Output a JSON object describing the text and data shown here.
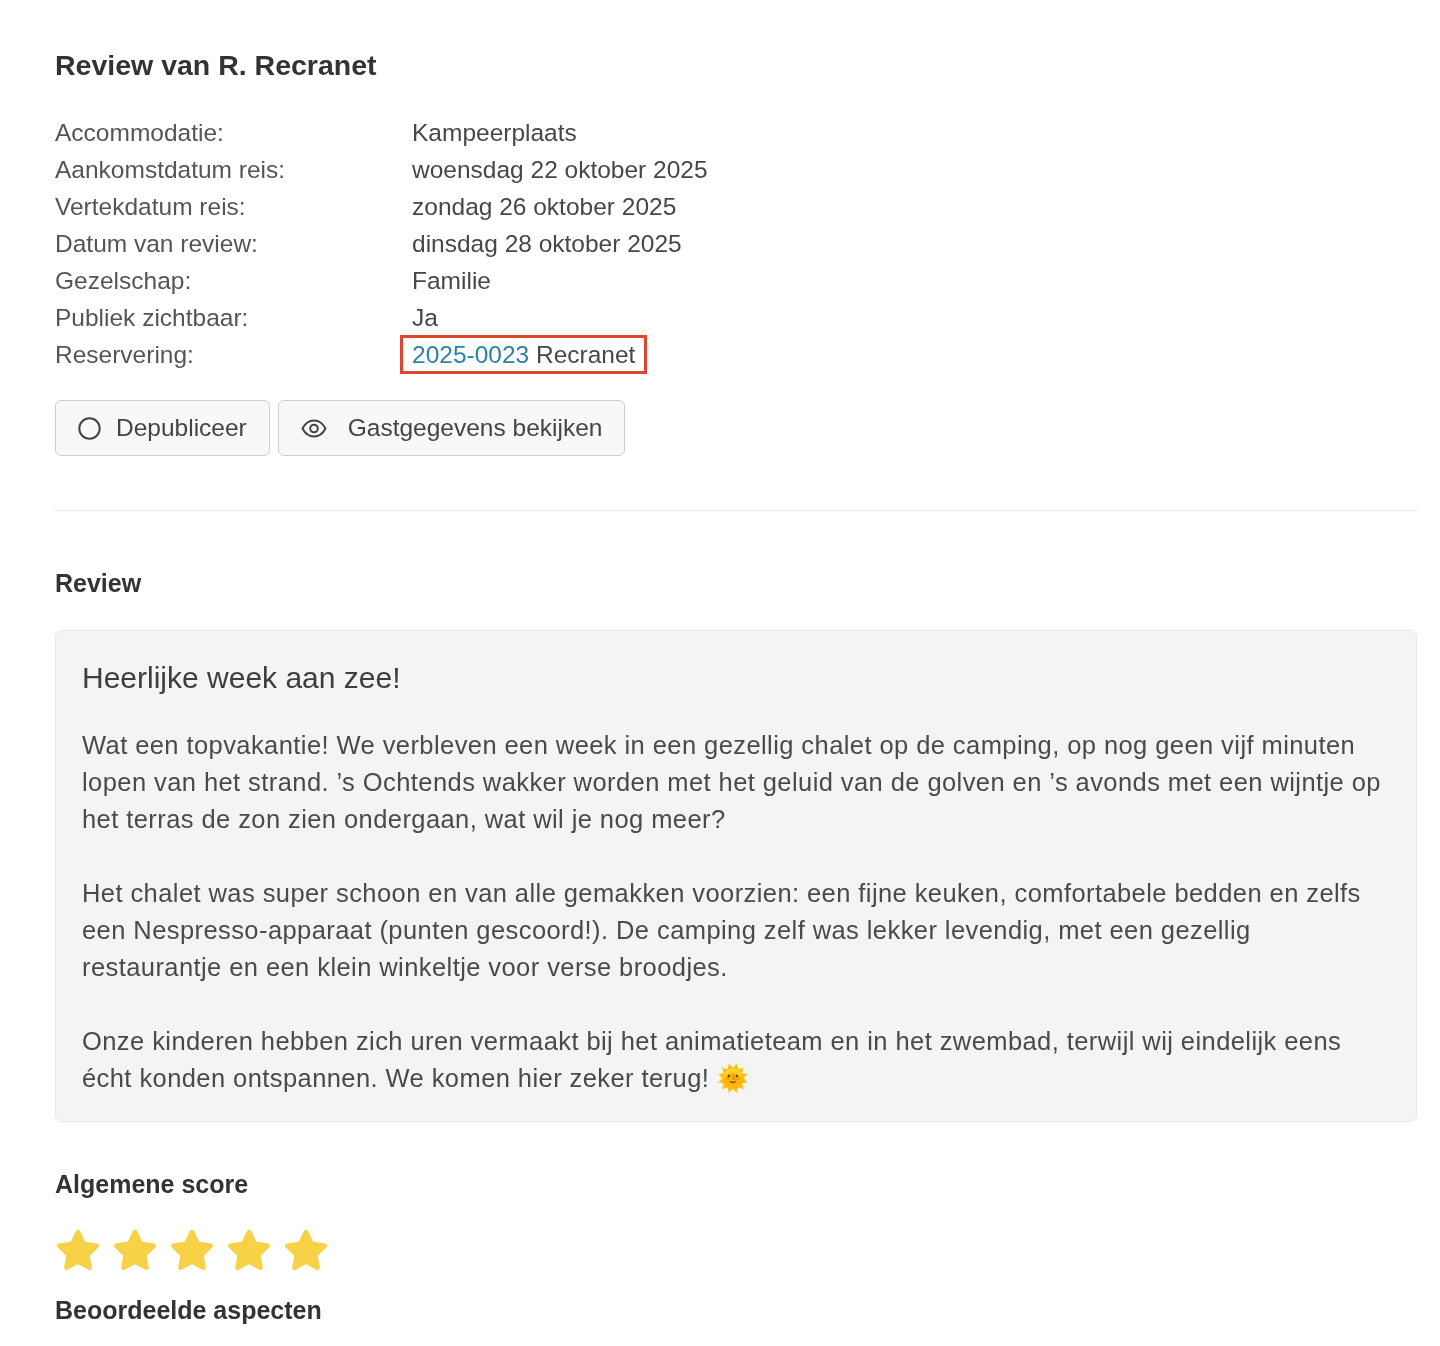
{
  "title": "Review van R. Recranet",
  "details": [
    {
      "label": "Accommodatie:",
      "value": "Kampeerplaats",
      "highlighted": false
    },
    {
      "label": "Aankomstdatum reis:",
      "value": "woensdag 22 oktober 2025",
      "highlighted": false
    },
    {
      "label": "Vertekdatum reis:",
      "value": "zondag 26 oktober 2025",
      "highlighted": false
    },
    {
      "label": "Datum van review:",
      "value": "dinsdag 28 oktober 2025",
      "highlighted": false
    },
    {
      "label": "Gezelschap:",
      "value": "Familie",
      "highlighted": false
    },
    {
      "label": "Publiek zichtbaar:",
      "value": "Ja",
      "highlighted": false
    },
    {
      "label": "Reservering:",
      "link": "2025-0023",
      "value": "Recranet",
      "highlighted": true
    }
  ],
  "buttons": [
    {
      "label": "Depubliceer"
    },
    {
      "label": "Gastgegevens bekijken"
    }
  ],
  "review": {
    "heading": "Review",
    "title": "Heerlijke week aan zee!",
    "paragraphs": [
      "Wat een topvakantie! We verbleven een week in een gezellig chalet op de camping, op nog geen vijf minuten lopen van het strand. ’s Ochtends wakker worden met het geluid van de golven en ’s avonds met een wijntje op het terras de zon zien ondergaan, wat wil je nog meer?",
      "Het chalet was super schoon en van alle gemakken voorzien: een fijne keuken, comfortabele bedden en zelfs een Nespresso-apparaat (punten gescoord!). De camping zelf was lekker levendig, met een gezellig restaurantje en een klein winkeltje voor verse broodjes.",
      "Onze kinderen hebben zich uren vermaakt bij het animatieteam en in het zwembad, terwijl wij eindelijk eens écht konden ontspannen. We komen hier zeker terug! 🌞"
    ]
  },
  "score": {
    "heading": "Algemene score",
    "stars": 5
  },
  "aspects": {
    "heading": "Beoordeelde aspecten"
  }
}
